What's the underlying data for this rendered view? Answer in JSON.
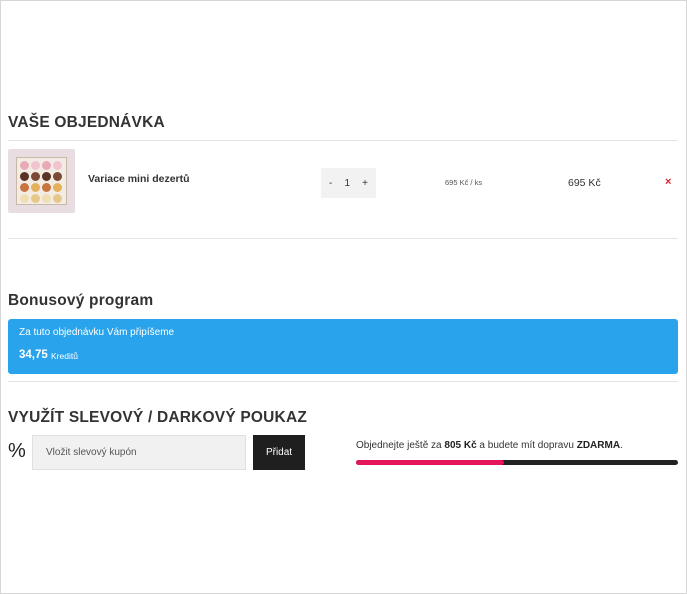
{
  "order": {
    "title": "VAŠE OBJEDNÁVKA",
    "items": [
      {
        "name": "Variace mini dezertů",
        "quantity": "1",
        "minus": "-",
        "plus": "+",
        "unit_price": "695 Kč / ks",
        "total": "695 Kč",
        "remove": "×"
      }
    ]
  },
  "bonus": {
    "title": "Bonusový program",
    "line": "Za tuto objednávku Vám připíšeme",
    "amount": "34,75",
    "unit": "Kreditů",
    "color": "#29a3eb"
  },
  "voucher": {
    "title": "VYUŽÍT SLEVOVÝ / DARKOVÝ POUKAZ",
    "icon": "%",
    "placeholder": "Vložit slevový kupón",
    "button": "Přidat"
  },
  "shipping": {
    "text_before": "Objednejte ještě za ",
    "remaining": "805 Kč",
    "text_middle": " a budete mít dopravu ",
    "free": "ZDARMA",
    "text_after": ".",
    "progress": 0.46,
    "progress_color": "#e5155a",
    "track_color": "#222222"
  }
}
